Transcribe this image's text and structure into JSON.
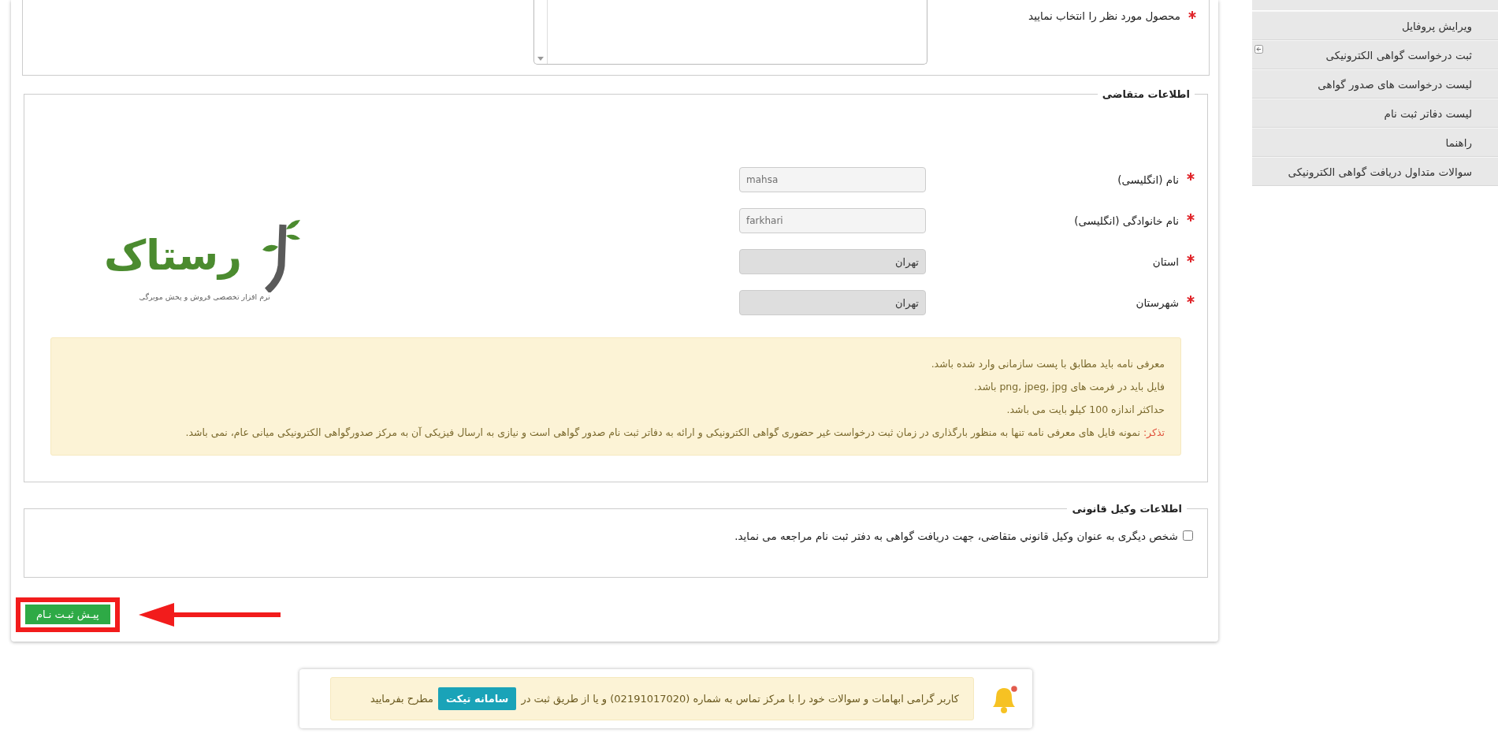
{
  "sidebar": {
    "items": [
      {
        "label": "ویرایش پروفایل",
        "has_submenu": false
      },
      {
        "label": "ثبت درخواست گواهی الکترونیکی",
        "has_submenu": true
      },
      {
        "label": "لیست درخواست های صدور گواهی",
        "has_submenu": false
      },
      {
        "label": "لیست دفاتر ثبت نام",
        "has_submenu": false
      },
      {
        "label": "راهنما",
        "has_submenu": false
      },
      {
        "label": "سوالات متداول دریافت گواهی الکترونیکی",
        "has_submenu": false
      }
    ]
  },
  "product": {
    "label": "محصول مورد نظر را انتخاب نمایید",
    "required": true
  },
  "applicant": {
    "legend": "اطلاعات متقاضی",
    "fields": [
      {
        "label": "نام (انگلیسی)",
        "required": true,
        "value": "mahsa",
        "disabled": false
      },
      {
        "label": "نام خانوادگی (انگلیسی)",
        "required": true,
        "value": "farkhari",
        "disabled": false
      },
      {
        "label": "استان",
        "required": true,
        "value": "تهران",
        "disabled": true
      },
      {
        "label": "شهرستان",
        "required": true,
        "value": "تهران",
        "disabled": true
      }
    ]
  },
  "logo": {
    "name": "رستاک",
    "tagline": "نرم افزار تخصصی فروش و پخش مویرگی"
  },
  "notes": [
    {
      "kind": "plain",
      "text": "معرفی نامه باید مطابق با پست سازمانی وارد شده باشد."
    },
    {
      "kind": "plain",
      "text": "فایل باید در فرمت های png, jpeg, jpg باشد."
    },
    {
      "kind": "plain",
      "text": "حداکثر اندازه 100 کیلو بایت می باشد."
    },
    {
      "kind": "warning",
      "prefix": "تذکر:",
      "text": "نمونه فایل های معرفی نامه تنها به منظور بارگذاری در زمان ثبت درخواست غیر حضوری گواهی الکترونیکی و ارائه به دفاتر ثبت نام صدور گواهی است و نیازی به ارسال فیزیکی آن به مرکز صدورگواهی الکترونیکی میانی عام، نمی باشد."
    }
  ],
  "legal": {
    "legend": "اطلاعات وکیل قانونی",
    "checkbox": {
      "label": "شخص دیگری به عنوان وکیل قانوني متقاضی، جهت دریافت گواهی به دفتر ثبت نام مراجعه می نماید.",
      "checked": false
    }
  },
  "submit": {
    "label": "پیـش ثبـت نـام"
  },
  "footer": {
    "text_before": "کاربر گرامی ابهامات و سوالات خود را با مرکز تماس به شماره (02191017020) و یا از طریق ثبت در",
    "button": "سامانه تیکت",
    "text_after": "مطرح بفرمایید",
    "has_alert": true
  }
}
